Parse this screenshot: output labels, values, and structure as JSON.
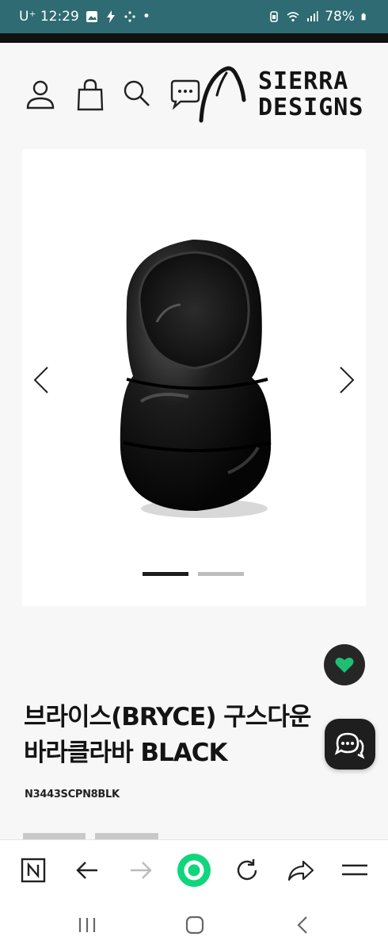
{
  "status_bar": {
    "time": "U⁺ 12:29",
    "dot": "•",
    "battery": "78%"
  },
  "brand": {
    "line1": "SIERRA",
    "line2": "DESIGNS"
  },
  "gallery": {
    "slide_index": 1,
    "slide_count": 2
  },
  "product": {
    "title_line1": "브라이스(BRYCE) 구스다운",
    "title_line2": "바라클라바 BLACK",
    "sku": "N3443SCPN8BLK"
  },
  "colors": {
    "status_bar": "#2e6b73",
    "wish_heart": "#1fbf73",
    "browser_home": "#0fd67c"
  }
}
